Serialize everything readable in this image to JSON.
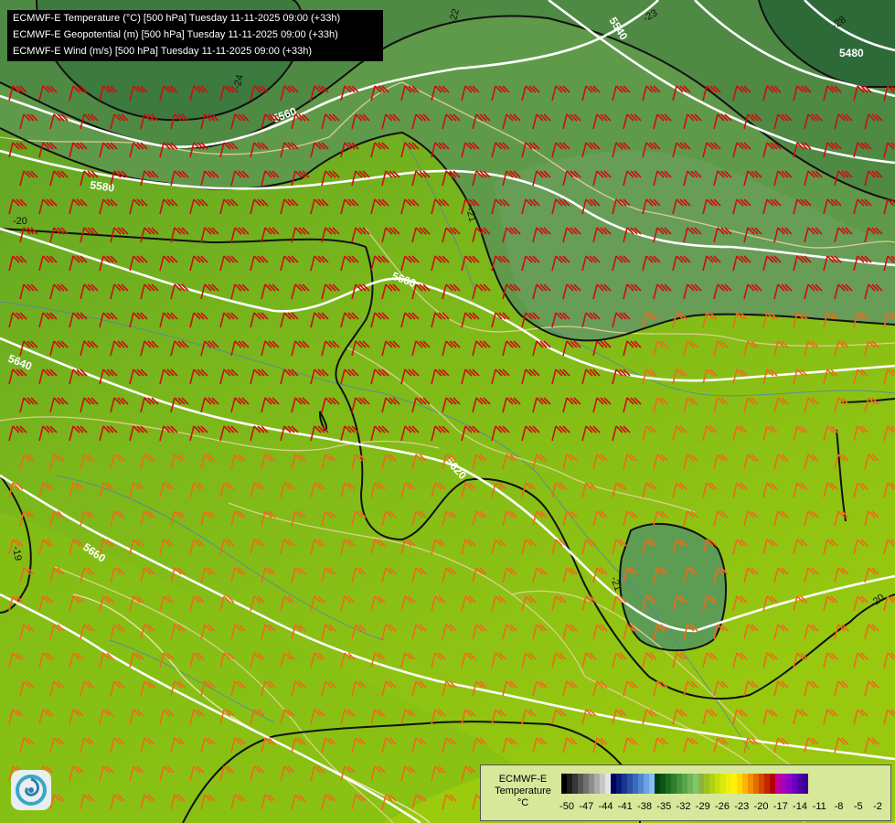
{
  "titles": [
    "ECMWF-E Temperature (°C) [500 hPa] Tuesday 11-11-2025 09:00 (+33h)",
    "ECMWF-E Geopotential (m) [500 hPa] Tuesday 11-11-2025 09:00 (+33h)",
    "ECMWF-E Wind (m/s) [500 hPa] Tuesday 11-11-2025 09:00 (+33h)"
  ],
  "geopotential_labels": [
    "5480",
    "5540",
    "5560",
    "5580",
    "5600",
    "5620",
    "5640",
    "5660"
  ],
  "temperature_labels": [
    "-19",
    "-20",
    "-21",
    "-22",
    "-23",
    "-24",
    "-28"
  ],
  "legend": {
    "title_lines": [
      "ECMWF-E",
      "Temperature",
      "°C"
    ],
    "ticks": [
      "-50",
      "-47",
      "-44",
      "-41",
      "-38",
      "-35",
      "-32",
      "-29",
      "-26",
      "-23",
      "-20",
      "-17",
      "-14",
      "-11",
      "-8",
      "-5",
      "-2"
    ],
    "colors": [
      "#000000",
      "#1c1c1c",
      "#383838",
      "#555555",
      "#717171",
      "#8e8e8e",
      "#aaaaaa",
      "#c7c7c7",
      "#e3e3e3",
      "#000060",
      "#0a1a7a",
      "#1a3590",
      "#2a50a8",
      "#3a6bbe",
      "#4e86d2",
      "#6aa2e2",
      "#86bdf0",
      "#00400f",
      "#0d5514",
      "#1c6a1f",
      "#2f7e2e",
      "#43923c",
      "#57a54a",
      "#6cb659",
      "#7fc668",
      "#8fb23a",
      "#9cc21e",
      "#b0d214",
      "#c5e00e",
      "#dbea0a",
      "#eef20a",
      "#fff20a",
      "#ffd800",
      "#ffb400",
      "#f29000",
      "#e36c00",
      "#d34800",
      "#c42400",
      "#b50000",
      "#c0009a",
      "#a800b8",
      "#8a00c8",
      "#6c00c0",
      "#4e00a8",
      "#3a0090"
    ],
    "logo_name": "ecmwf-swirl-icon"
  }
}
